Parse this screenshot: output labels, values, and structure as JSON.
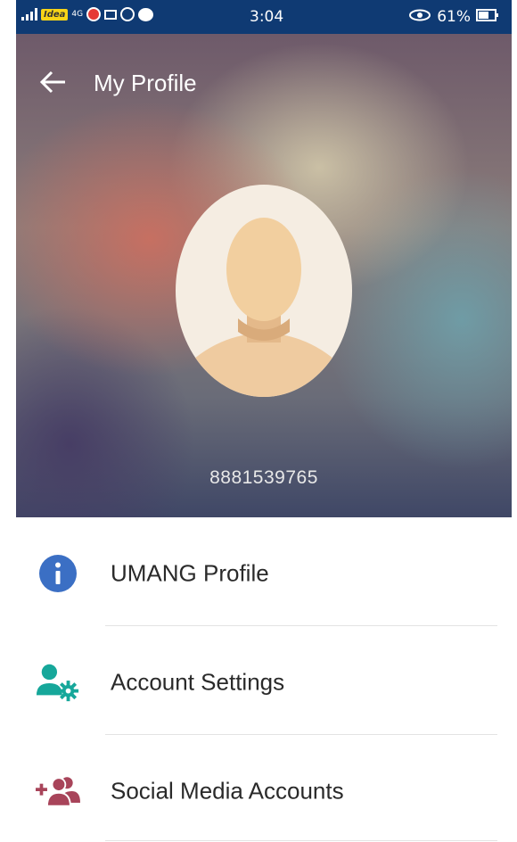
{
  "status_bar": {
    "carrier": "Idea",
    "network": "4G",
    "time": "3:04",
    "battery": "61%"
  },
  "header": {
    "title": "My Profile"
  },
  "profile": {
    "phone": "8881539765"
  },
  "menu": [
    {
      "label": "UMANG Profile",
      "icon": "info-icon",
      "color": "#3b6fc4"
    },
    {
      "label": "Account Settings",
      "icon": "user-settings-icon",
      "color": "#16a79a"
    },
    {
      "label": "Social Media Accounts",
      "icon": "add-users-icon",
      "color": "#a8445a"
    }
  ]
}
